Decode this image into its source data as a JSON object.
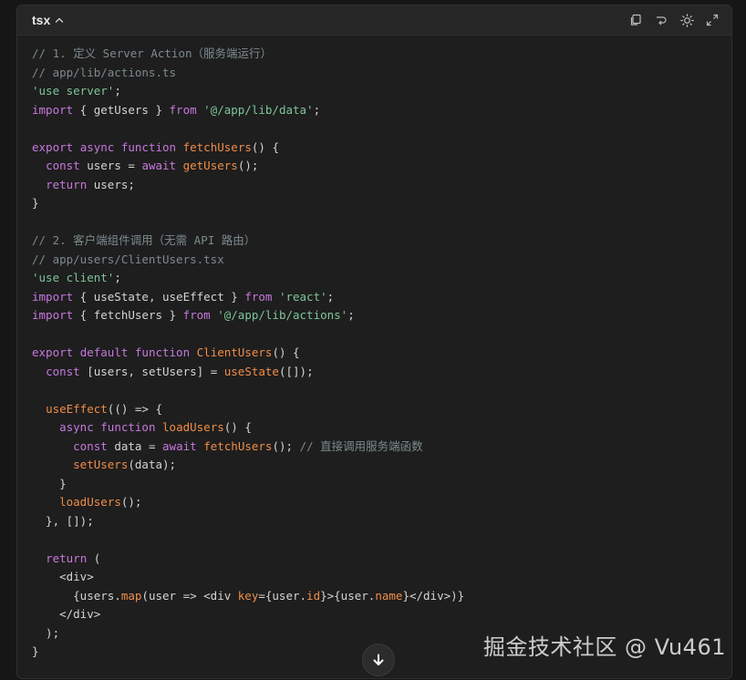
{
  "header": {
    "language": "tsx"
  },
  "toolbar": {
    "copy_icon": "copy-icon",
    "wrap_icon": "wrap-icon",
    "theme_icon": "sun-icon",
    "expand_icon": "expand-icon"
  },
  "code_lines": [
    [
      [
        "c",
        "// 1. 定义 Server Action（服务端运行）"
      ]
    ],
    [
      [
        "c",
        "// app/lib/actions.ts"
      ]
    ],
    [
      [
        "s",
        "'use server'"
      ],
      [
        "p",
        ";"
      ]
    ],
    [
      [
        "k",
        "import"
      ],
      [
        "p",
        " { getUsers } "
      ],
      [
        "k",
        "from"
      ],
      [
        "p",
        " "
      ],
      [
        "s",
        "'@/app/lib/data'"
      ],
      [
        "p",
        ";"
      ]
    ],
    [],
    [
      [
        "k",
        "export"
      ],
      [
        "p",
        " "
      ],
      [
        "k",
        "async"
      ],
      [
        "p",
        " "
      ],
      [
        "k",
        "function"
      ],
      [
        "p",
        " "
      ],
      [
        "f",
        "fetchUsers"
      ],
      [
        "p",
        "() {"
      ]
    ],
    [
      [
        "p",
        "  "
      ],
      [
        "k",
        "const"
      ],
      [
        "p",
        " users = "
      ],
      [
        "k",
        "await"
      ],
      [
        "p",
        " "
      ],
      [
        "f",
        "getUsers"
      ],
      [
        "p",
        "();"
      ]
    ],
    [
      [
        "p",
        "  "
      ],
      [
        "k",
        "return"
      ],
      [
        "p",
        " users;"
      ]
    ],
    [
      [
        "p",
        "}"
      ]
    ],
    [],
    [
      [
        "c",
        "// 2. 客户端组件调用（无需 API 路由）"
      ]
    ],
    [
      [
        "c",
        "// app/users/ClientUsers.tsx"
      ]
    ],
    [
      [
        "s",
        "'use client'"
      ],
      [
        "p",
        ";"
      ]
    ],
    [
      [
        "k",
        "import"
      ],
      [
        "p",
        " { useState, useEffect } "
      ],
      [
        "k",
        "from"
      ],
      [
        "p",
        " "
      ],
      [
        "s",
        "'react'"
      ],
      [
        "p",
        ";"
      ]
    ],
    [
      [
        "k",
        "import"
      ],
      [
        "p",
        " { fetchUsers } "
      ],
      [
        "k",
        "from"
      ],
      [
        "p",
        " "
      ],
      [
        "s",
        "'@/app/lib/actions'"
      ],
      [
        "p",
        ";"
      ]
    ],
    [],
    [
      [
        "k",
        "export"
      ],
      [
        "p",
        " "
      ],
      [
        "k",
        "default"
      ],
      [
        "p",
        " "
      ],
      [
        "k",
        "function"
      ],
      [
        "p",
        " "
      ],
      [
        "f",
        "ClientUsers"
      ],
      [
        "p",
        "() {"
      ]
    ],
    [
      [
        "p",
        "  "
      ],
      [
        "k",
        "const"
      ],
      [
        "p",
        " [users, setUsers] = "
      ],
      [
        "f",
        "useState"
      ],
      [
        "p",
        "([]);"
      ]
    ],
    [],
    [
      [
        "p",
        "  "
      ],
      [
        "f",
        "useEffect"
      ],
      [
        "p",
        "(() => {"
      ]
    ],
    [
      [
        "p",
        "    "
      ],
      [
        "k",
        "async"
      ],
      [
        "p",
        " "
      ],
      [
        "k",
        "function"
      ],
      [
        "p",
        " "
      ],
      [
        "f",
        "loadUsers"
      ],
      [
        "p",
        "() {"
      ]
    ],
    [
      [
        "p",
        "      "
      ],
      [
        "k",
        "const"
      ],
      [
        "p",
        " data = "
      ],
      [
        "k",
        "await"
      ],
      [
        "p",
        " "
      ],
      [
        "f",
        "fetchUsers"
      ],
      [
        "p",
        "(); "
      ],
      [
        "c",
        "// 直接调用服务端函数"
      ]
    ],
    [
      [
        "p",
        "      "
      ],
      [
        "f",
        "setUsers"
      ],
      [
        "p",
        "(data);"
      ]
    ],
    [
      [
        "p",
        "    }"
      ]
    ],
    [
      [
        "p",
        "    "
      ],
      [
        "f",
        "loadUsers"
      ],
      [
        "p",
        "();"
      ]
    ],
    [
      [
        "p",
        "  }, []);"
      ]
    ],
    [],
    [
      [
        "p",
        "  "
      ],
      [
        "k",
        "return"
      ],
      [
        "p",
        " ("
      ]
    ],
    [
      [
        "p",
        "    <div>"
      ]
    ],
    [
      [
        "p",
        "      {users."
      ],
      [
        "f",
        "map"
      ],
      [
        "p",
        "(user => <div "
      ],
      [
        "a",
        "key"
      ],
      [
        "p",
        "={user."
      ],
      [
        "a",
        "id"
      ],
      [
        "p",
        "}>{user."
      ],
      [
        "a",
        "name"
      ],
      [
        "p",
        "}</div>)}"
      ]
    ],
    [
      [
        "p",
        "    </div>"
      ]
    ],
    [
      [
        "p",
        "  );"
      ]
    ],
    [
      [
        "p",
        "}"
      ]
    ]
  ],
  "watermark": "掘金技术社区 @ Vu461",
  "scroll_icon": "arrow-down-icon",
  "colors": {
    "comment": "#7d8a8f",
    "string": "#7ec699",
    "keyword": "#c678dd",
    "function": "#f08d49",
    "text": "#d4d4d4",
    "background": "#1e1e1e"
  }
}
